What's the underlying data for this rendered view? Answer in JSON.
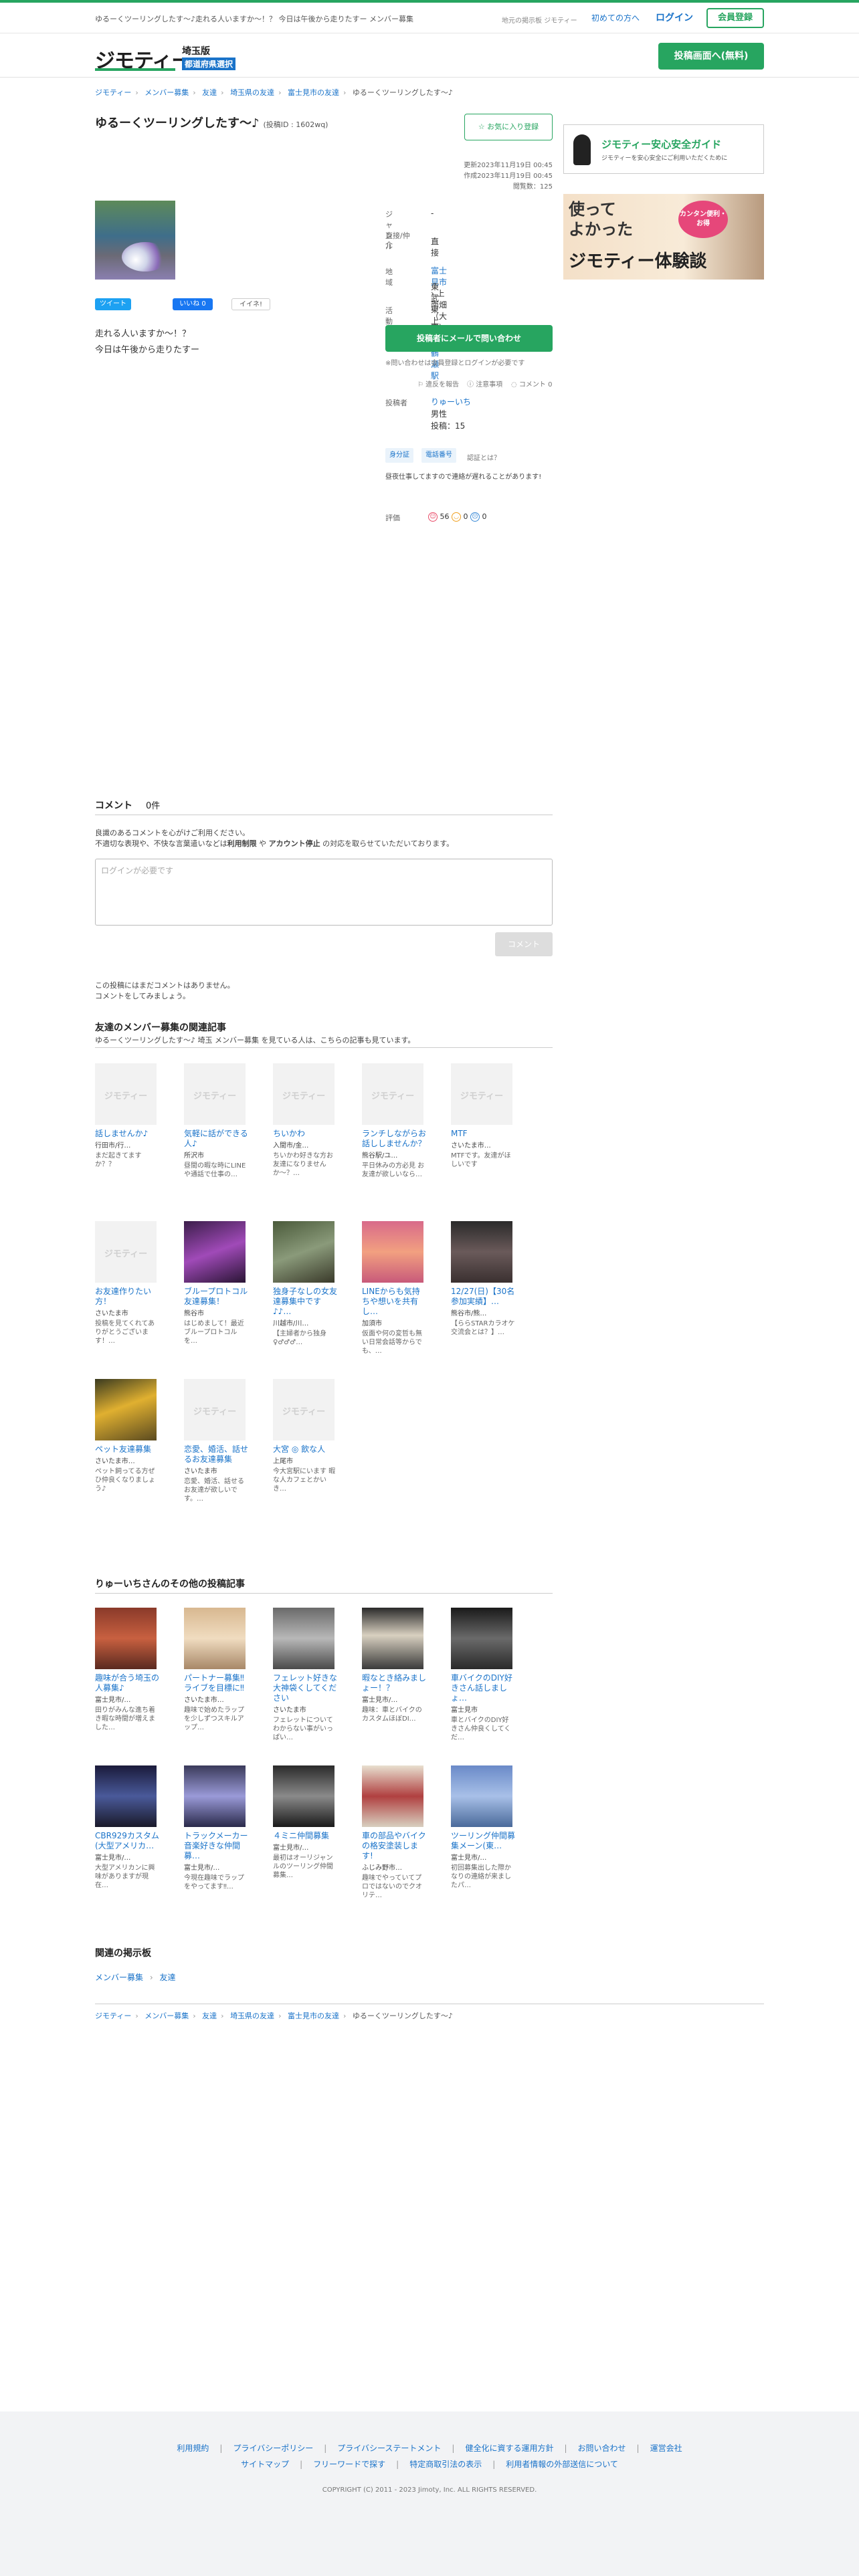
{
  "topbar": {
    "tagline": "ゆるーくツーリングしたす〜♪走れる人いますか〜！？ 今日は午後から走りたすー メンバー募集",
    "area_link": "地元の掲示板 ジモティー",
    "first_link": "初めての方へ",
    "login": "ログイン",
    "register": "会員登録"
  },
  "header": {
    "logo": "ジモティー",
    "pref": "埼玉版",
    "pref_sub": "都道府県選択",
    "post_button": "投稿画面へ(無料)"
  },
  "breadcrumb": [
    "ジモティー",
    "メンバー募集",
    "友達",
    "埼玉県の友達",
    "富士見市の友達",
    "ゆるーくツーリングしたす〜♪"
  ],
  "post": {
    "title": "ゆるーくツーリングしたす〜♪",
    "post_id": "(投稿ID : 1602wq)",
    "fav_button": "お気に入り登録",
    "updated": "更新2023年11月19日 00:45",
    "created": "作成2023年11月19日 00:45",
    "views": "閲覧数：125",
    "description_line1": "走れる人いますか〜！？",
    "description_line2": "今日は午後から走りたすー"
  },
  "share": {
    "tweet": "ツイート",
    "like": "いいね 0",
    "iine": "イイネ!"
  },
  "info": {
    "genre_label": "ジャンル",
    "genre_value": "-",
    "direct_label": "直接/仲介",
    "direct_value": "直接",
    "area_label": "地域",
    "area_city": "富士見市",
    "area_town": "上南畑（大字）",
    "area_line": "東武東上線",
    "area_station": "鶴瀬駅",
    "place_label": "活動場所",
    "place_value": "-",
    "contact_button": "投稿者にメールで問い合わせ",
    "contact_note": "※問い合わせは会員登録とログインが必要です",
    "report": "違反を報告",
    "caution": "注意事項",
    "comment_count": "コメント 0",
    "poster_label": "投稿者",
    "poster_name": "りゅーいち",
    "poster_gender": "男性",
    "poster_posts": "投稿：15",
    "tag1": "身分証",
    "tag2": "電話番号",
    "tag3": "認証とは？",
    "shift_note": "昼夜仕事してますので連絡が遅れることがあります!",
    "rating_label": "評価",
    "rating_good": "56",
    "rating_normal": "0",
    "rating_bad": "0"
  },
  "side": {
    "banner1_title": "ジモティー安心安全ガイド",
    "banner1_sub": "ジモティーを安心安全にご利用いただくために",
    "banner2_line1": "使って",
    "banner2_line2": "よかった",
    "banner2_line3": "ジモティー体験談",
    "banner2_badge": "カンタン便利・お得"
  },
  "comments": {
    "title": "コメント",
    "count": "0件",
    "note1": "良識のあるコメントを心がけご利用ください。",
    "note2": "不適切な表現や、不快な言葉遣いなどは",
    "note_bold1": "利用制限",
    "note_mid": " や ",
    "note_bold2": "アカウント停止",
    "note3": " の対応を取らせていただいております。",
    "placeholder": "ログインが必要です",
    "button": "コメント",
    "empty1": "この投稿にはまだコメントはありません。",
    "empty2": "コメントをしてみましょう。"
  },
  "related": {
    "title": "友達のメンバー募集の関連記事",
    "subtitle": "ゆるーくツーリングしたす〜♪ 埼玉 メンバー募集 を見ている人は、こちらの記事も見ています。",
    "noimage": "ジモティー",
    "items": [
      {
        "title": "話しませんか♪",
        "loc": "行田市/行…",
        "snip": "まだ起きてますか？？"
      },
      {
        "title": "気軽に話ができる人♪",
        "loc": "所沢市",
        "snip": "昼間の暇な時にLINEや通話で仕事の…"
      },
      {
        "title": "ちいかわ",
        "loc": "入間市/金…",
        "snip": "ちいかわ好きな方お友達になりませんか〜？…"
      },
      {
        "title": "ランチしながらお話ししませんか？",
        "loc": "熊谷駅/ユ…",
        "snip": "平日休みの方必見 お友達が欲しいなら…"
      },
      {
        "title": "MTF",
        "loc": "さいたま市…",
        "snip": "MTFです。友達がほしいです"
      },
      {
        "title": "お友達作りたい方！",
        "loc": "さいたま市",
        "snip": "投稿を見てくれてありがとうございます！…"
      },
      {
        "title": "ブループロトコル友達募集！",
        "loc": "熊谷市",
        "snip": "はじめまして！最近ブループロトコルを…"
      },
      {
        "title": "独身子なしの女友達募集中です♪♪…",
        "loc": "川越市/川…",
        "snip": "【主婦者から独身♀♂♂♂…"
      },
      {
        "title": "LINEからも気持ちや想いを共有し…",
        "loc": "加須市",
        "snip": "仮面や何の変哲も無い日常会話等からでも、…"
      },
      {
        "title": "12/27(日)【30名参加実績】…",
        "loc": "熊谷市/熊…",
        "snip": "【ららSTARカラオケ交流会とは？】…"
      },
      {
        "title": "ペット友達募集",
        "loc": "さいたま市…",
        "snip": "ペット飼ってる方ぜひ仲良くなりましょう♪"
      },
      {
        "title": "恋愛、婚活、話せるお友達募集",
        "loc": "さいたま市",
        "snip": "恋愛、婚活、話せるお友達が欲しいです。…"
      },
      {
        "title": "大宮 ◎ 飲な人",
        "loc": "上尾市",
        "snip": "今大宮駅にいます 暇な人カフェとかいき…"
      }
    ]
  },
  "other": {
    "title": "りゅーいちさんのその他の投稿記事",
    "items": [
      {
        "title": "趣味が合う埼玉の人募集♪",
        "loc": "富士見市/…",
        "snip": "田りがみんな進ち着き暇な時間が増えました…"
      },
      {
        "title": "パートナー募集‼︎ライブを目標に‼︎",
        "loc": "さいたま市…",
        "snip": "趣味で始めたラップを少しずつスキルアップ…"
      },
      {
        "title": "フェレット好きな大神袋くしてください",
        "loc": "さいたま市",
        "snip": "フェレットについてわからない事がいっぱい…"
      },
      {
        "title": "暇なとき絡みましょー！？",
        "loc": "富士見市/…",
        "snip": "趣味：車とバイクのカスタムほぼDI…"
      },
      {
        "title": "車バイクのDIY好きさん話しましょ…",
        "loc": "富士見市",
        "snip": "車とバイクのDIY好きさん仲良くしてくだ…"
      },
      {
        "title": "CBR929カスタム(大型アメリカ…",
        "loc": "富士見市/…",
        "snip": "大型アメリカンに興味がありますが現在…"
      },
      {
        "title": "トラックメーカー音楽好きな仲間募…",
        "loc": "富士見市/…",
        "snip": "今現在趣味でラップをやってます‼︎…"
      },
      {
        "title": "４ミニ仲間募集",
        "loc": "富士見市/…",
        "snip": "最初はオーリジャンルのツーリング仲間募集…"
      },
      {
        "title": "車の部品やバイクの格安塗装します!",
        "loc": "ふじみ野市…",
        "snip": "趣味でやっていてプロではないのでクオリテ…"
      },
      {
        "title": "ツーリング仲間募集メーン(東…",
        "loc": "富士見市/…",
        "snip": "初回募集出した際かなりの連絡が来ましたパ…"
      }
    ]
  },
  "board": {
    "title": "関連の掲示板",
    "link1": "メンバー募集",
    "link2": "友達"
  },
  "footer": {
    "row1": [
      "利用規約",
      "プライバシーポリシー",
      "プライバシーステートメント",
      "健全化に資する運用方針",
      "お問い合わせ",
      "運営会社"
    ],
    "row2": [
      "サイトマップ",
      "フリーワードで探す",
      "特定商取引法の表示",
      "利用者情報の外部送信について"
    ],
    "copyright": "COPYRIGHT (C) 2011 - 2023 Jimoty, Inc. ALL RIGHTS RESERVED."
  },
  "colors": {
    "brand_green": "#27a560",
    "link_blue": "#1a73c9"
  }
}
